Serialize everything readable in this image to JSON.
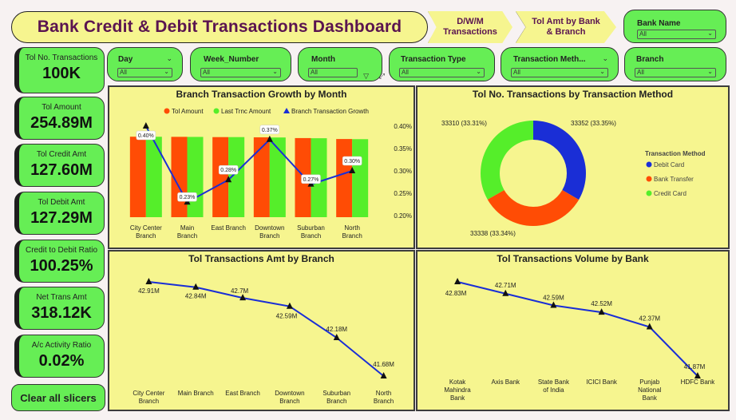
{
  "header": {
    "title": "Bank Credit & Debit Transactions Dashboard",
    "nav_dwm": "D/W/M Transactions",
    "nav_bank_branch": "Tol Amt by Bank & Branch"
  },
  "slicers": {
    "bank_name": {
      "label": "Bank Name",
      "value": "All"
    },
    "day": {
      "label": "Day",
      "value": "All"
    },
    "week": {
      "label": "Week_Number",
      "value": "All"
    },
    "month": {
      "label": "Month",
      "value": "All"
    },
    "txn_type": {
      "label": "Transaction Type",
      "value": "All"
    },
    "txn_method": {
      "label": "Transaction Meth...",
      "value": "All"
    },
    "branch": {
      "label": "Branch",
      "value": "All"
    }
  },
  "kpis": [
    {
      "label": "Tol No. Transactions",
      "value": "100K"
    },
    {
      "label": "Tol Amount",
      "value": "254.89M"
    },
    {
      "label": "Tol Credit Amt",
      "value": "127.60M"
    },
    {
      "label": "Tol Debit Amt",
      "value": "127.29M"
    },
    {
      "label": "Credit to Debit Ratio",
      "value": "100.25%"
    },
    {
      "label": "Net Trans Amt",
      "value": "318.12K"
    },
    {
      "label": "A/c Activity Ratio",
      "value": "0.02%"
    }
  ],
  "clear_label": "Clear all slicers",
  "colors": {
    "orange": "#ff4c05",
    "green": "#55ee2a",
    "blue": "#1a2ed6",
    "panel": "#f6f58f",
    "slicer": "#66ee55",
    "title_text": "#5a1450"
  },
  "chart_data": [
    {
      "type": "bar",
      "title": "Branch Transaction Growth by Month",
      "categories": [
        "City Center\nBranch",
        "Main\nBranch",
        "East Branch",
        "Downtown\nBranch",
        "Suburban\nBranch",
        "North\nBranch"
      ],
      "series": [
        {
          "name": "Tol Amount",
          "type": "bar",
          "values": [
            42.91,
            42.84,
            42.7,
            42.59,
            42.18,
            41.68
          ]
        },
        {
          "name": "Last Trnc Amount",
          "type": "bar",
          "values": [
            42.88,
            42.8,
            42.7,
            42.5,
            42.1,
            41.6
          ]
        },
        {
          "name": "Branch Transaction Growth",
          "type": "line",
          "axis": "right",
          "values": [
            0.4,
            0.23,
            0.28,
            0.37,
            0.27,
            0.3
          ],
          "labels": [
            "0.40%",
            "0.23%",
            "0.28%",
            "0.37%",
            "0.27%",
            "0.30%"
          ]
        }
      ],
      "y2_ticks": [
        "0.40%",
        "0.35%",
        "0.30%",
        "0.25%",
        "0.20%"
      ],
      "y2lim": [
        0.2,
        0.4
      ]
    },
    {
      "type": "pie",
      "title": "Tol No. Transactions by Transaction Method",
      "legend_title": "Transaction Method",
      "slices": [
        {
          "name": "Debit Card",
          "value": 33352,
          "label": "33352 (33.35%)"
        },
        {
          "name": "Bank Transfer",
          "value": 33338,
          "label": "33338 (33.34%)"
        },
        {
          "name": "Credit Card",
          "value": 33310,
          "label": "33310 (33.31%)"
        }
      ]
    },
    {
      "type": "line",
      "title": "Tol Transactions Amt by Branch",
      "categories": [
        "City Center\nBranch",
        "Main Branch",
        "East Branch",
        "Downtown\nBranch",
        "Suburban\nBranch",
        "North\nBranch"
      ],
      "values": [
        42.91,
        42.84,
        42.7,
        42.59,
        42.18,
        41.68
      ],
      "labels": [
        "42.91M",
        "42.84M",
        "42.7M",
        "42.59M",
        "42.18M",
        "41.68M"
      ]
    },
    {
      "type": "line",
      "title": "Tol Transactions Volume by Bank",
      "categories": [
        "Kotak\nMahindra\nBank",
        "Axis Bank",
        "State Bank\nof India",
        "ICICI Bank",
        "Punjab\nNational\nBank",
        "HDFC Bank"
      ],
      "values": [
        42.83,
        42.71,
        42.59,
        42.52,
        42.37,
        41.87
      ],
      "labels": [
        "42.83M",
        "42.71M",
        "42.59M",
        "42.52M",
        "42.37M",
        "41.87M"
      ]
    }
  ]
}
